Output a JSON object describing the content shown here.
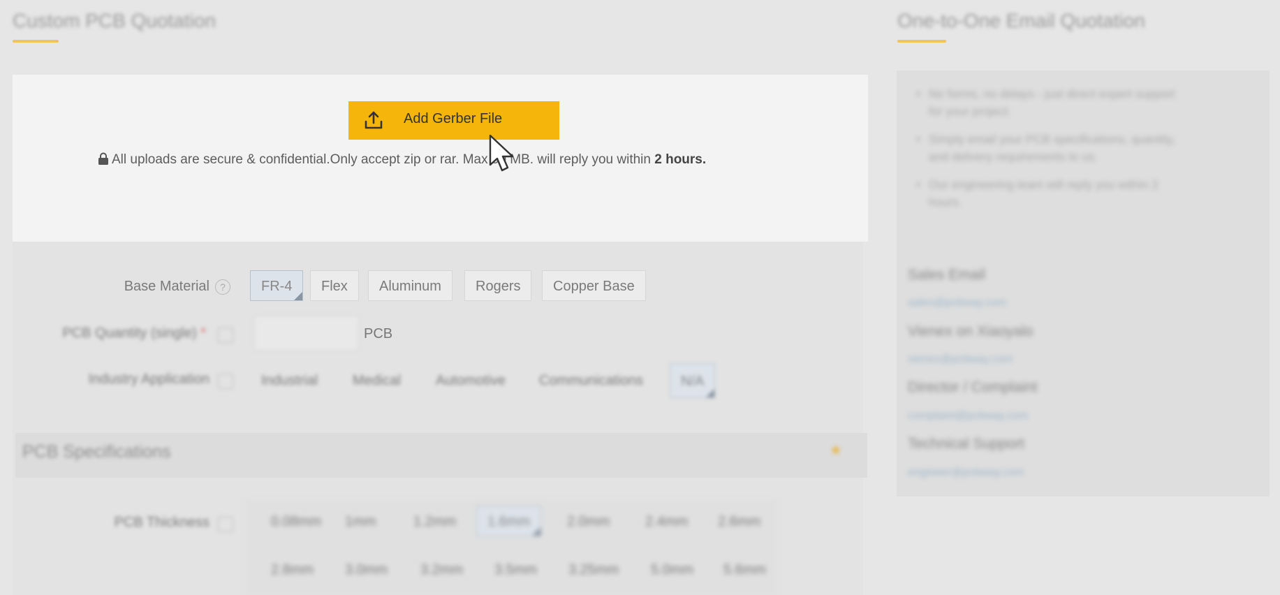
{
  "left_heading": "Custom PCB Quotation",
  "right_heading": "One-to-One Email Quotation",
  "upload": {
    "button_label": "Add Gerber File",
    "secure_text": "All uploads are secure & confidential.Only accept zip or rar. Max 50 MB. will reply you within ",
    "reply_time": "2 hours.",
    "icon": "upload-icon",
    "accent_color": "#f5b50a"
  },
  "base_material": {
    "label": "Base Material",
    "options": [
      "FR-4",
      "Flex",
      "Aluminum",
      "Rogers",
      "Copper Base"
    ],
    "selected": "FR-4"
  },
  "quantity": {
    "label": "PCB Quantity (single)",
    "required_mark": "*",
    "value": "",
    "unit": "PCB"
  },
  "industry": {
    "label": "Industry Application",
    "options": [
      "Industrial",
      "Medical",
      "Automotive",
      "Communications",
      "N/A"
    ],
    "selected": "N/A"
  },
  "specs": {
    "title": "PCB Specifications",
    "thickness_label": "PCB Thickness",
    "thickness_row1": [
      "0.08mm",
      "1mm",
      "1.2mm",
      "1.6mm",
      "2.0mm",
      "2.4mm",
      "2.6mm"
    ],
    "thickness_row2": [
      "2.8mm",
      "3.0mm",
      "3.2mm",
      "3.5mm",
      "3.25mm",
      "5.0mm",
      "5.6mm"
    ],
    "selected": "1.6mm"
  },
  "right_panel": {
    "bullets": [
      "No forms, no delays - just direct expert support",
      "for your project.",
      "Simply email your PCB specifications, quantity,",
      "and delivery requirements to us.",
      "Our engineering team will reply you within 2",
      "hours."
    ],
    "contacts": [
      {
        "title": "Sales Email",
        "email": "sales@pcbway.com"
      },
      {
        "title": "Vienex on Xiaoyalo",
        "email": "vienex@pcbway.com"
      },
      {
        "title": "Director / Complaint",
        "email": "complaint@pcbway.com"
      },
      {
        "title": "Technical Support",
        "email": "engineer@pcbway.com"
      }
    ]
  }
}
